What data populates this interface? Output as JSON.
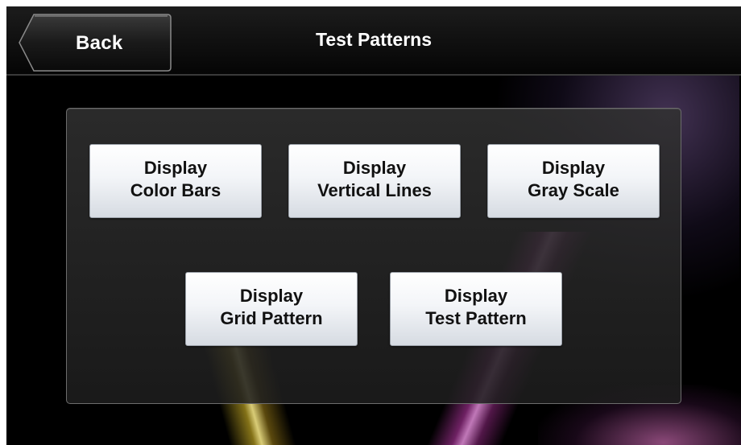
{
  "header": {
    "back_label": "Back",
    "title": "Test Patterns"
  },
  "buttons": [
    {
      "line1": "Display",
      "line2": "Color Bars"
    },
    {
      "line1": "Display",
      "line2": "Vertical Lines"
    },
    {
      "line1": "Display",
      "line2": "Gray Scale"
    },
    {
      "line1": "Display",
      "line2": "Grid Pattern"
    },
    {
      "line1": "Display",
      "line2": "Test Pattern"
    }
  ],
  "colors": {
    "background": "#000000",
    "button_face": "#f3f5f8",
    "button_text": "#111111",
    "title_text": "#ffffff"
  }
}
